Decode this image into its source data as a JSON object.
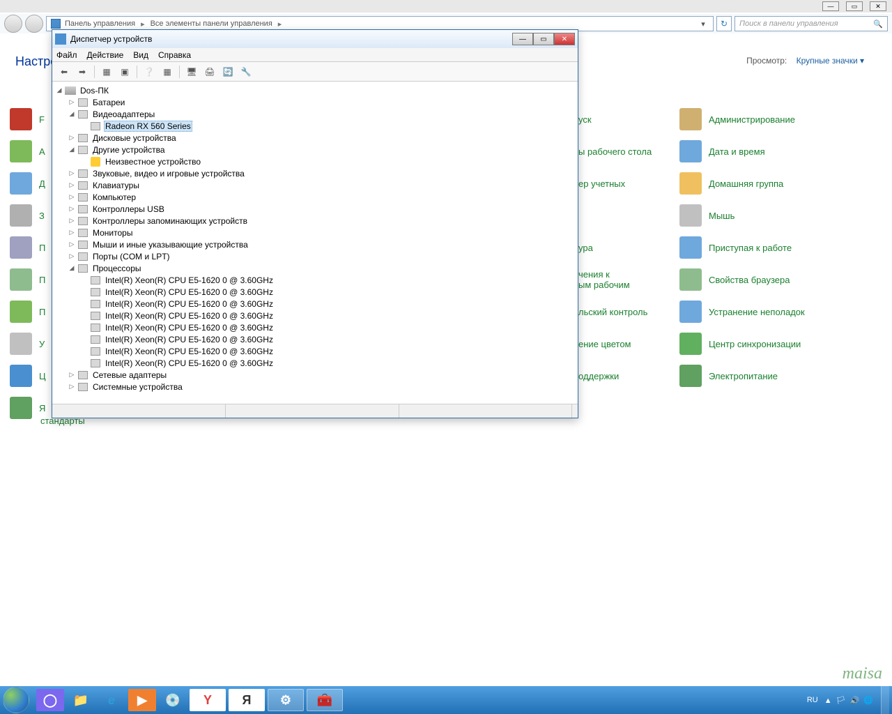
{
  "control_panel": {
    "window_buttons": {
      "minimize": "—",
      "maximize": "▭",
      "close": "✕"
    },
    "breadcrumb": {
      "parts": [
        "Панель управления",
        "Все элементы панели управления"
      ],
      "sep": "▸",
      "dropdown": "▾"
    },
    "refresh": "↻",
    "search_placeholder": "Поиск в панели управления",
    "search_icon": "🔍",
    "heading": "Настро",
    "view_label": "Просмотр:",
    "view_value": "Крупные значки ▾",
    "left_items": [
      {
        "label": "F",
        "color": "#c0392b"
      },
      {
        "label": "А",
        "color": "#7fba5a"
      },
      {
        "label": "Д",
        "color": "#6fa8dc"
      },
      {
        "label": "З",
        "color": "#b0b0b0"
      },
      {
        "label": "П",
        "color": "#a0a0c0"
      },
      {
        "label": "П",
        "color": "#8fbc8f"
      },
      {
        "label": "П",
        "color": "#7fba5a"
      },
      {
        "label": "У",
        "color": "#c0c0c0"
      },
      {
        "label": "Ц",
        "color": "#4a8fd0"
      },
      {
        "label": "Я",
        "color": "#60a060"
      }
    ],
    "mid_items": [
      {
        "label": "уск",
        "color": "#e0e0e0"
      },
      {
        "label": "ы рабочего стола",
        "color": "#e0e0e0"
      },
      {
        "label": "ер учетных",
        "color": "#e0e0e0"
      },
      {
        "label": "",
        "color": "#e0e0e0"
      },
      {
        "label": "ура",
        "color": "#e0e0e0"
      },
      {
        "label": "чения к\nым рабочим",
        "color": "#e0e0e0"
      },
      {
        "label": "льский контроль",
        "color": "#e0e0e0"
      },
      {
        "label": "ение цветом",
        "color": "#e0e0e0"
      },
      {
        "label": "оддержки",
        "color": "#e0e0e0"
      },
      {
        "label": "",
        "color": "#e0e0e0"
      }
    ],
    "right_items": [
      {
        "label": "Администрирование",
        "color": "#d0b070"
      },
      {
        "label": "Дата и время",
        "color": "#6fa8dc"
      },
      {
        "label": "Домашняя группа",
        "color": "#f0c060"
      },
      {
        "label": "Мышь",
        "color": "#c0c0c0"
      },
      {
        "label": "Приступая к работе",
        "color": "#6fa8dc"
      },
      {
        "label": "Свойства браузера",
        "color": "#8fbc8f"
      },
      {
        "label": "Устранение неполадок",
        "color": "#6fa8dc"
      },
      {
        "label": "Центр синхронизации",
        "color": "#60b060"
      },
      {
        "label": "Электропитание",
        "color": "#60a060"
      }
    ],
    "standalone": "стандарты"
  },
  "device_manager": {
    "title": "Диспетчер устройств",
    "menu": [
      "Файл",
      "Действие",
      "Вид",
      "Справка"
    ],
    "toolbar": [
      "⬅",
      "➡",
      "|",
      "▦",
      "▣",
      "|",
      "❔",
      "▦",
      "|",
      "🖥",
      "🖨",
      "🔄",
      "🔧"
    ],
    "root": "Dos-ПК",
    "tree": [
      {
        "label": "Батареи",
        "expanded": false,
        "children": []
      },
      {
        "label": "Видеоадаптеры",
        "expanded": true,
        "children": [
          {
            "label": "Radeon RX 560 Series",
            "selected": true
          }
        ]
      },
      {
        "label": "Дисковые устройства",
        "expanded": false,
        "children": []
      },
      {
        "label": "Другие устройства",
        "expanded": true,
        "children": [
          {
            "label": "Неизвестное устройство",
            "warn": true
          }
        ]
      },
      {
        "label": "Звуковые, видео и игровые устройства",
        "expanded": false,
        "children": []
      },
      {
        "label": "Клавиатуры",
        "expanded": false,
        "children": []
      },
      {
        "label": "Компьютер",
        "expanded": false,
        "children": []
      },
      {
        "label": "Контроллеры USB",
        "expanded": false,
        "children": []
      },
      {
        "label": "Контроллеры запоминающих устройств",
        "expanded": false,
        "children": []
      },
      {
        "label": "Мониторы",
        "expanded": false,
        "children": []
      },
      {
        "label": "Мыши и иные указывающие устройства",
        "expanded": false,
        "children": []
      },
      {
        "label": "Порты (COM и LPT)",
        "expanded": false,
        "children": []
      },
      {
        "label": "Процессоры",
        "expanded": true,
        "children": [
          {
            "label": "Intel(R) Xeon(R) CPU E5-1620 0 @ 3.60GHz"
          },
          {
            "label": "Intel(R) Xeon(R) CPU E5-1620 0 @ 3.60GHz"
          },
          {
            "label": "Intel(R) Xeon(R) CPU E5-1620 0 @ 3.60GHz"
          },
          {
            "label": "Intel(R) Xeon(R) CPU E5-1620 0 @ 3.60GHz"
          },
          {
            "label": "Intel(R) Xeon(R) CPU E5-1620 0 @ 3.60GHz"
          },
          {
            "label": "Intel(R) Xeon(R) CPU E5-1620 0 @ 3.60GHz"
          },
          {
            "label": "Intel(R) Xeon(R) CPU E5-1620 0 @ 3.60GHz"
          },
          {
            "label": "Intel(R) Xeon(R) CPU E5-1620 0 @ 3.60GHz"
          }
        ]
      },
      {
        "label": "Сетевые адаптеры",
        "expanded": false,
        "children": []
      },
      {
        "label": "Системные устройства",
        "expanded": false,
        "children": []
      }
    ]
  },
  "taskbar": {
    "pinned": [
      {
        "name": "cortana",
        "glyph": "◯",
        "bg": "#7b68ee"
      },
      {
        "name": "explorer",
        "glyph": "📁",
        "bg": ""
      },
      {
        "name": "ie",
        "glyph": "e",
        "bg": "",
        "color": "#2e9cd8",
        "style": "italic"
      },
      {
        "name": "wmp",
        "glyph": "▶",
        "bg": "#f08030"
      },
      {
        "name": "setup",
        "glyph": "💿",
        "bg": ""
      },
      {
        "name": "yandex",
        "glyph": "Y",
        "bg": "#fff",
        "color": "#e04040",
        "active": true
      },
      {
        "name": "yandex-search",
        "glyph": "Я",
        "bg": "#fff",
        "color": "#333",
        "active": true
      },
      {
        "name": "control-panel",
        "glyph": "⚙",
        "bg": "",
        "active": true
      },
      {
        "name": "toolbox",
        "glyph": "🧰",
        "bg": "",
        "active": true
      }
    ],
    "tray_lang": "RU",
    "tray_icons": [
      "▲",
      "🏳",
      "🔊",
      "🌐"
    ]
  },
  "watermark": "maisa"
}
